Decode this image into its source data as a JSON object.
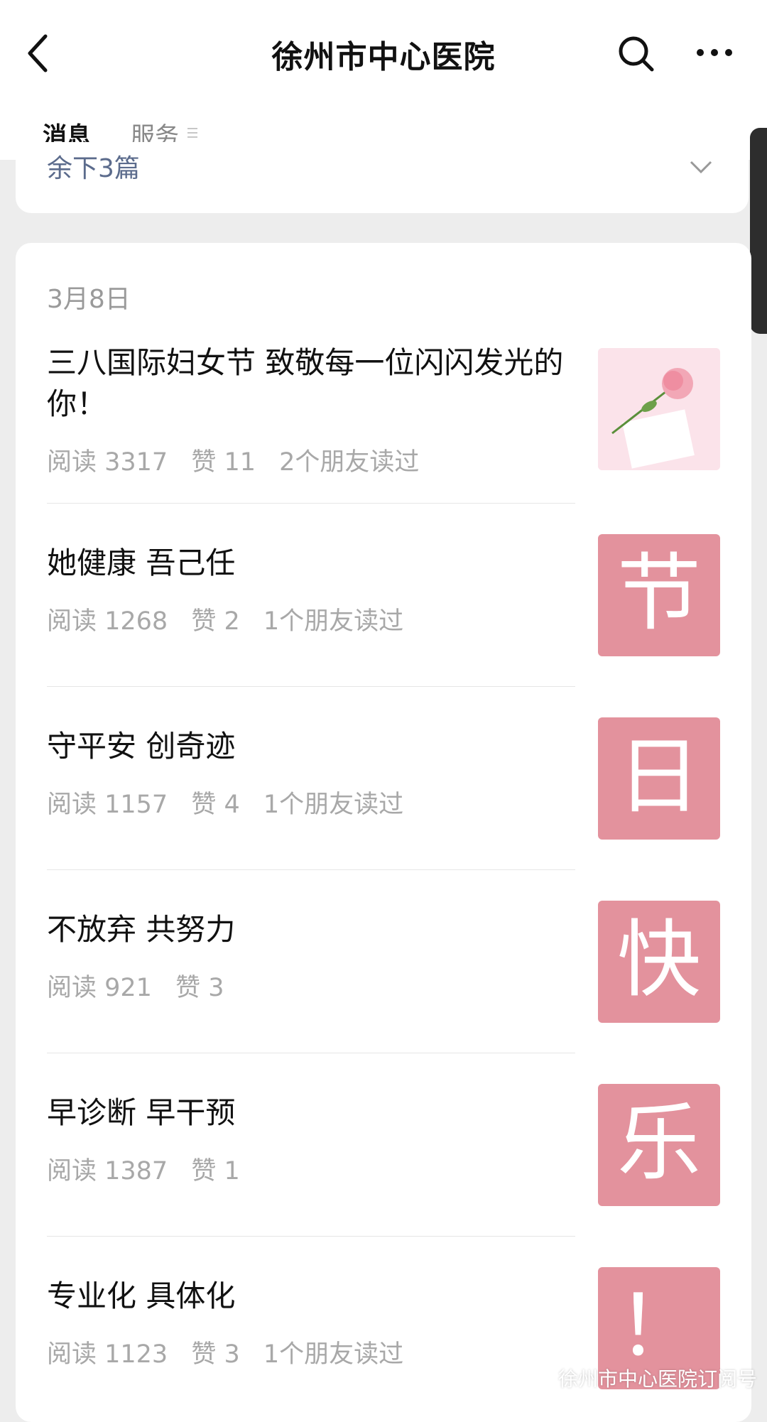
{
  "header": {
    "title": "徐州市中心医院",
    "back_icon": "back-arrow-icon",
    "search_icon": "search-icon",
    "more_icon": "more-icon"
  },
  "tabs": [
    {
      "label": "消息",
      "active": true
    },
    {
      "label": "服务"
    }
  ],
  "top_card": {
    "remaining": "余下3篇"
  },
  "feed": {
    "date": "3月8日",
    "articles": [
      {
        "title": "三八国际妇女节 致敬每一位闪闪发光的你！",
        "reads": "阅读 3317",
        "likes": "赞 11",
        "friends": "2个朋友读过",
        "thumb_text": ""
      },
      {
        "title": "她健康 吾己任",
        "reads": "阅读 1268",
        "likes": "赞 2",
        "friends": "1个朋友读过",
        "thumb_text": "节"
      },
      {
        "title": "守平安 创奇迹",
        "reads": "阅读 1157",
        "likes": "赞 4",
        "friends": "1个朋友读过",
        "thumb_text": "日"
      },
      {
        "title": "不放弃 共努力",
        "reads": "阅读 921",
        "likes": "赞 3",
        "friends": "",
        "thumb_text": "快"
      },
      {
        "title": "早诊断 早干预",
        "reads": "阅读 1387",
        "likes": "赞 1",
        "friends": "",
        "thumb_text": "乐"
      },
      {
        "title": "专业化 具体化",
        "reads": "阅读 1123",
        "likes": "赞 3",
        "friends": "1个朋友读过",
        "thumb_text": "！"
      }
    ]
  },
  "watermark": "徐州市中心医院订阅号",
  "colors": {
    "thumb_pink": "#e3929d",
    "meta_gray": "#a8a8a8"
  }
}
